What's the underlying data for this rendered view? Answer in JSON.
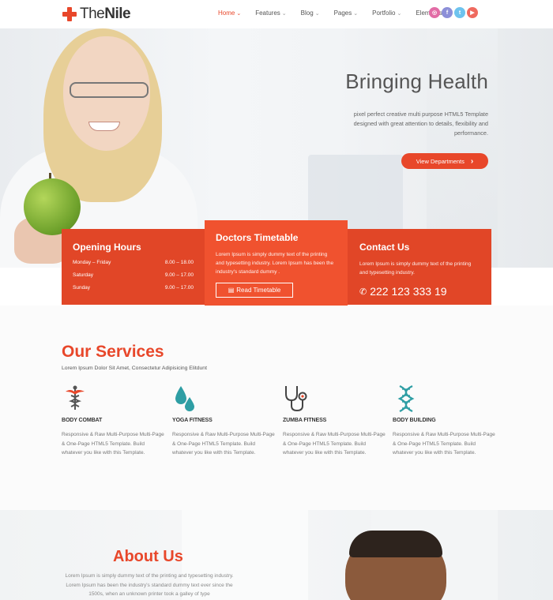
{
  "brand": {
    "name_prefix": "The",
    "name_suffix": "Nile",
    "accent": "#e8472a"
  },
  "nav": {
    "items": [
      {
        "label": "Home",
        "active": true
      },
      {
        "label": "Features",
        "active": false
      },
      {
        "label": "Blog",
        "active": false
      },
      {
        "label": "Pages",
        "active": false
      },
      {
        "label": "Portfolio",
        "active": false
      },
      {
        "label": "Elements",
        "active": false
      }
    ],
    "chevron": "⌄"
  },
  "socials": [
    {
      "icon": "instagram-icon",
      "glyph": "◎",
      "color": "#e26ca6"
    },
    {
      "icon": "facebook-icon",
      "glyph": "f",
      "color": "#8c8fd8"
    },
    {
      "icon": "twitter-icon",
      "glyph": "t",
      "color": "#6ec3ee"
    },
    {
      "icon": "youtube-icon",
      "glyph": "▶",
      "color": "#ef6a5f"
    }
  ],
  "hero": {
    "title": "Bringing Health",
    "description": "pixel perfect creative multi purpose HTML5 Template designed with great attention to details, flexibility and performance.",
    "button_label": "View Departments",
    "button_icon": "›"
  },
  "opening_hours": {
    "title": "Opening Hours",
    "rows": [
      {
        "day": "Monday – Friday",
        "time": "8.00 – 18.00"
      },
      {
        "day": "Saturday",
        "time": "9.00 – 17.00"
      },
      {
        "day": "Sunday",
        "time": "9.00 – 17.00"
      }
    ]
  },
  "doctors": {
    "title": "Doctors Timetable",
    "text": "Lorem Ipsum is simply dummy text of the printing and typesetting industry. Lorem Ipsum has been the industry's standard dummy .",
    "button_label": "Read Timetable",
    "button_icon": "▤"
  },
  "contact": {
    "title": "Contact Us",
    "text": "Lorem Ipsum is simply dummy text of the printing and typesetting industry.",
    "phone": "222 123 333 19",
    "phone_icon": "✆"
  },
  "services": {
    "title": "Our Services",
    "subtitle": "Lorem Ipsum Dolor Sit Amet, Consectetur Adipisicing Elitdunt",
    "items": [
      {
        "icon": "caduceus-icon",
        "name": "BODY COMBAT",
        "desc": "Responsive & Raw Multi-Purpose Multi-Page & One-Page HTML5 Template. Build whatever you like with this Template."
      },
      {
        "icon": "drops-icon",
        "name": "YOGA FITNESS",
        "desc": "Responsive & Raw Multi-Purpose Multi-Page & One-Page HTML5 Template. Build whatever you like with this Template."
      },
      {
        "icon": "stethoscope-icon",
        "name": "ZUMBA FITNESS",
        "desc": "Responsive & Raw Multi-Purpose Multi-Page & One-Page HTML5 Template. Build whatever you like with this Template."
      },
      {
        "icon": "dna-icon",
        "name": "BODY BUILDING",
        "desc": "Responsive & Raw Multi-Purpose Multi-Page & One-Page HTML5 Template. Build whatever you like with this Template."
      }
    ]
  },
  "about": {
    "title": "About Us",
    "text": "Lorem Ipsum is simply dummy text of the printing and typesetting industry. Lorem Ipsum has been the industry's standard dummy text ever since the 1500s, when an unknown printer took a galley of type"
  }
}
